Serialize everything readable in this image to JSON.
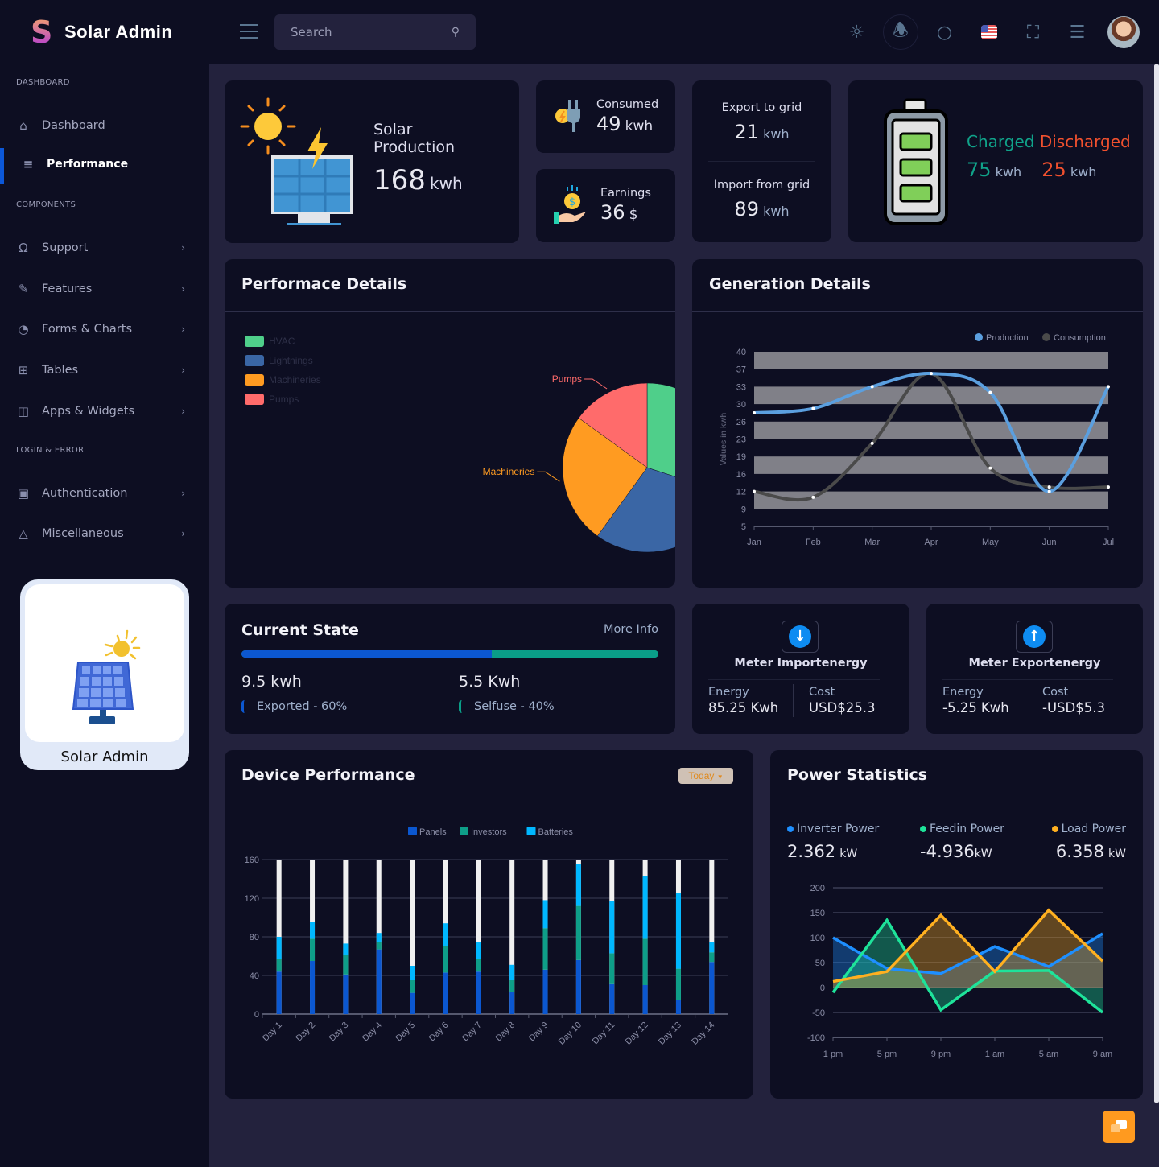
{
  "app": {
    "title": "Solar Admin"
  },
  "search": {
    "placeholder": "Search"
  },
  "header_icons": [
    "sun-icon",
    "bell-icon",
    "chat-icon",
    "us-flag-icon",
    "fullscreen-icon",
    "sliders-icon",
    "avatar"
  ],
  "sidebar": {
    "sections": [
      {
        "title": "DASHBOARD"
      },
      {
        "title": "COMPONENTS"
      },
      {
        "title": "LOGIN & ERROR"
      }
    ],
    "items": [
      {
        "label": "Dashboard",
        "icon": "home-icon"
      },
      {
        "label": "Performance",
        "icon": "list-icon",
        "active": true
      },
      {
        "label": "Support",
        "icon": "headphones-icon"
      },
      {
        "label": "Features",
        "icon": "edit-icon"
      },
      {
        "label": "Forms & Charts",
        "icon": "pie-chart-icon"
      },
      {
        "label": "Tables",
        "icon": "grid-icon"
      },
      {
        "label": "Apps & Widgets",
        "icon": "database-icon"
      },
      {
        "label": "Authentication",
        "icon": "lock-icon"
      },
      {
        "label": "Miscellaneous",
        "icon": "warning-icon"
      }
    ],
    "promo_label": "Solar Admin"
  },
  "stats": {
    "solar": {
      "label1": "Solar",
      "label2": "Production",
      "value": "168",
      "unit": "kwh"
    },
    "consumed": {
      "label": "Consumed",
      "value": "49",
      "unit": "kwh"
    },
    "earnings": {
      "label": "Earnings",
      "value": "36",
      "unit": "$"
    },
    "export": {
      "label": "Export to grid",
      "value": "21",
      "unit": "kwh"
    },
    "import": {
      "label": "Import from grid",
      "value": "89",
      "unit": "kwh"
    },
    "battery": {
      "charged_label": "Charged",
      "discharged_label": "Discharged",
      "charged_value": "75",
      "discharged_value": "25",
      "unit": "kwh",
      "charged_color": "#10a38a",
      "discharged_color": "#f0502e"
    }
  },
  "performance_card": {
    "title": "Performace Details"
  },
  "generation_card": {
    "title": "Generation Details"
  },
  "current_state": {
    "title": "Current State",
    "more": "More Info",
    "exported_pct": 60,
    "selfuse_pct": 40,
    "left_value": "9.5 kwh",
    "left_label": "Exported - 60%",
    "right_value": "5.5 Kwh",
    "right_label": "Selfuse - 40%"
  },
  "meters": [
    {
      "title": "Meter Importenergy",
      "direction": "down",
      "energy_label": "Energy",
      "energy": "85.25 Kwh",
      "cost_label": "Cost",
      "cost": "USD$25.3"
    },
    {
      "title": "Meter Exportenergy",
      "direction": "up",
      "energy_label": "Energy",
      "energy": "-5.25 Kwh",
      "cost_label": "Cost",
      "cost": "-USD$5.3"
    }
  ],
  "device_card": {
    "title": "Device Performance",
    "filter": "Today"
  },
  "power_card": {
    "title": "Power Statistics",
    "metrics": [
      {
        "label": "Inverter Power",
        "value": "2.362",
        "unit": "kW",
        "color": "#1e8fff"
      },
      {
        "label": "Feedin Power",
        "value": "-4.936",
        "unit": "kW",
        "color": "#1ee39a"
      },
      {
        "label": "Load Power",
        "value": "6.358",
        "unit": "kW",
        "color": "#ffb020"
      }
    ]
  },
  "chart_data": [
    {
      "type": "pie",
      "title": "Performace Details",
      "categories": [
        "HVAC",
        "Lightnings",
        "Machineries",
        "Pumps"
      ],
      "values": [
        30,
        30,
        25,
        15
      ],
      "colors": [
        "#4fcf8a",
        "#3a66a5",
        "#ff9b21",
        "#ff6b6b"
      ],
      "legend": "top-left",
      "visible_labels": [
        "Pumps",
        "Machineries"
      ]
    },
    {
      "type": "line",
      "title": "Generation Details",
      "x": [
        "Jan",
        "Feb",
        "Mar",
        "Apr",
        "May",
        "Jun",
        "Jul"
      ],
      "series": [
        {
          "name": "Production",
          "values": [
            28,
            29,
            33,
            36,
            32,
            12,
            33
          ],
          "color": "#5b9fdf"
        },
        {
          "name": "Consumption",
          "values": [
            12,
            11,
            22,
            36,
            17,
            13,
            13
          ],
          "color": "#4a4a4a"
        }
      ],
      "ylabel": "Values in kwh",
      "yticks": [
        5,
        9,
        12,
        16,
        19,
        23,
        26,
        30,
        33,
        37,
        40
      ],
      "ylim": [
        5,
        40
      ],
      "legend": "top-right",
      "grid": "banded"
    },
    {
      "type": "bar",
      "stacked": true,
      "title": "Device Performance",
      "categories": [
        "Day 1",
        "Day 2",
        "Day 3",
        "Day 4",
        "Day 5",
        "Day 6",
        "Day 7",
        "Day 8",
        "Day 9",
        "Day 10",
        "Day 11",
        "Day 12",
        "Day 13",
        "Day 14"
      ],
      "series": [
        {
          "name": "Panels",
          "values": [
            44,
            55,
            41,
            67,
            22,
            43,
            44,
            23,
            46,
            56,
            31,
            30,
            15,
            54
          ],
          "color": "#0b57d0"
        },
        {
          "name": "Investors",
          "values": [
            13,
            23,
            20,
            8,
            13,
            27,
            13,
            12,
            43,
            56,
            32,
            48,
            32,
            10
          ],
          "color": "#0e9e88"
        },
        {
          "name": "Batteries",
          "values": [
            23,
            17,
            12,
            9,
            15,
            24,
            18,
            16,
            29,
            43,
            54,
            65,
            78,
            11
          ],
          "color": "#00b7ff"
        }
      ],
      "yticks": [
        0,
        40,
        80,
        120,
        160
      ],
      "ylim": [
        0,
        160
      ],
      "legend": "top-center"
    },
    {
      "type": "area",
      "title": "Power Statistics",
      "x": [
        "1 pm",
        "5 pm",
        "9 pm",
        "1 am",
        "5 am",
        "9 am"
      ],
      "series": [
        {
          "name": "Inverter Power",
          "values": [
            100,
            38,
            28,
            82,
            42,
            108
          ],
          "color": "#1e8fff"
        },
        {
          "name": "Feedin Power",
          "values": [
            -10,
            135,
            -45,
            33,
            34,
            -50
          ],
          "color": "#1ee39a"
        },
        {
          "name": "Load Power",
          "values": [
            12,
            32,
            145,
            32,
            155,
            53
          ],
          "color": "#ffb020"
        }
      ],
      "yticks": [
        -100,
        -50,
        0,
        50,
        100,
        150,
        200
      ],
      "ylim": [
        -100,
        200
      ]
    }
  ]
}
